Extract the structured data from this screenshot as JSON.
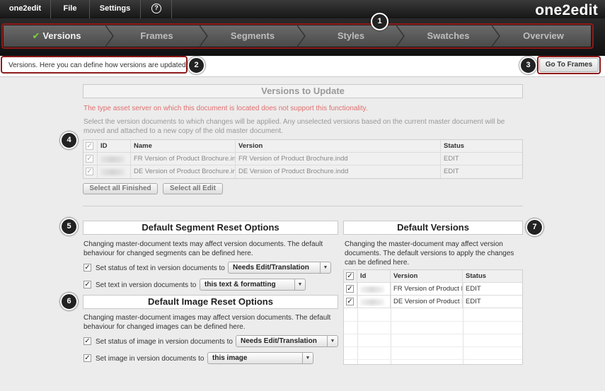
{
  "menu": {
    "app": "one2edit",
    "file": "File",
    "settings": "Settings",
    "help_glyph": "?",
    "logo": "one2edit"
  },
  "steps": [
    {
      "label": "Versions",
      "active": true
    },
    {
      "label": "Frames"
    },
    {
      "label": "Segments"
    },
    {
      "label": "Styles"
    },
    {
      "label": "Swatches"
    },
    {
      "label": "Overview"
    }
  ],
  "check_glyph": "✔",
  "callouts": [
    "1",
    "2",
    "3",
    "4",
    "5",
    "6",
    "7"
  ],
  "info": {
    "text": "Versions. Here you can define how versions are updated.",
    "go_button": "Go To Frames"
  },
  "versions_to_update": {
    "title": "Versions to Update",
    "warning": "The type asset server on which this document is located does not support this functionality.",
    "description": "Select the version documents to which changes will be applied. Any unselected versions based on the current master document will be moved and attached to a new copy of the old master document.",
    "columns": [
      "ID",
      "Name",
      "Version",
      "Status"
    ],
    "rows": [
      {
        "name": "FR Version of Product Brochure.in",
        "version": "FR Version of Product Brochure.indd",
        "status": "EDIT"
      },
      {
        "name": "DE Version of Product Brochure.in",
        "version": "DE Version of Product Brochure.indd",
        "status": "EDIT"
      }
    ],
    "select_finished": "Select all Finished",
    "select_edit": "Select all Edit"
  },
  "segment_reset": {
    "title": "Default Segment Reset Options",
    "description": "Changing master-document texts may affect version documents. The default behaviour for changed segments can be defined here.",
    "option1_label": "Set status of text in version documents to",
    "option1_value": "Needs Edit/Translation",
    "option2_label": "Set text in version documents to",
    "option2_value": "this text & formatting"
  },
  "image_reset": {
    "title": "Default Image Reset Options",
    "description": "Changing master-document images may affect version documents. The default behaviour for changed images can be defined here.",
    "option1_label": "Set status of image in version documents to",
    "option1_value": "Needs Edit/Translation",
    "option2_label": "Set image in version documents to",
    "option2_value": "this image"
  },
  "default_versions": {
    "title": "Default Versions",
    "description": "Changing the master-document may affect version documents. The default versions to apply the changes can be defined here.",
    "columns": [
      "Id",
      "Version",
      "Status"
    ],
    "rows": [
      {
        "version": "FR Version of Product B",
        "status": "EDIT"
      },
      {
        "version": "DE Version of Product B",
        "status": "EDIT"
      }
    ]
  },
  "colors": {
    "callout": "#8f1a1a",
    "check": "#7cd43a",
    "warning": "#e06f6f"
  },
  "icons": {
    "dropdown": "▼",
    "checkbox": "✓"
  }
}
